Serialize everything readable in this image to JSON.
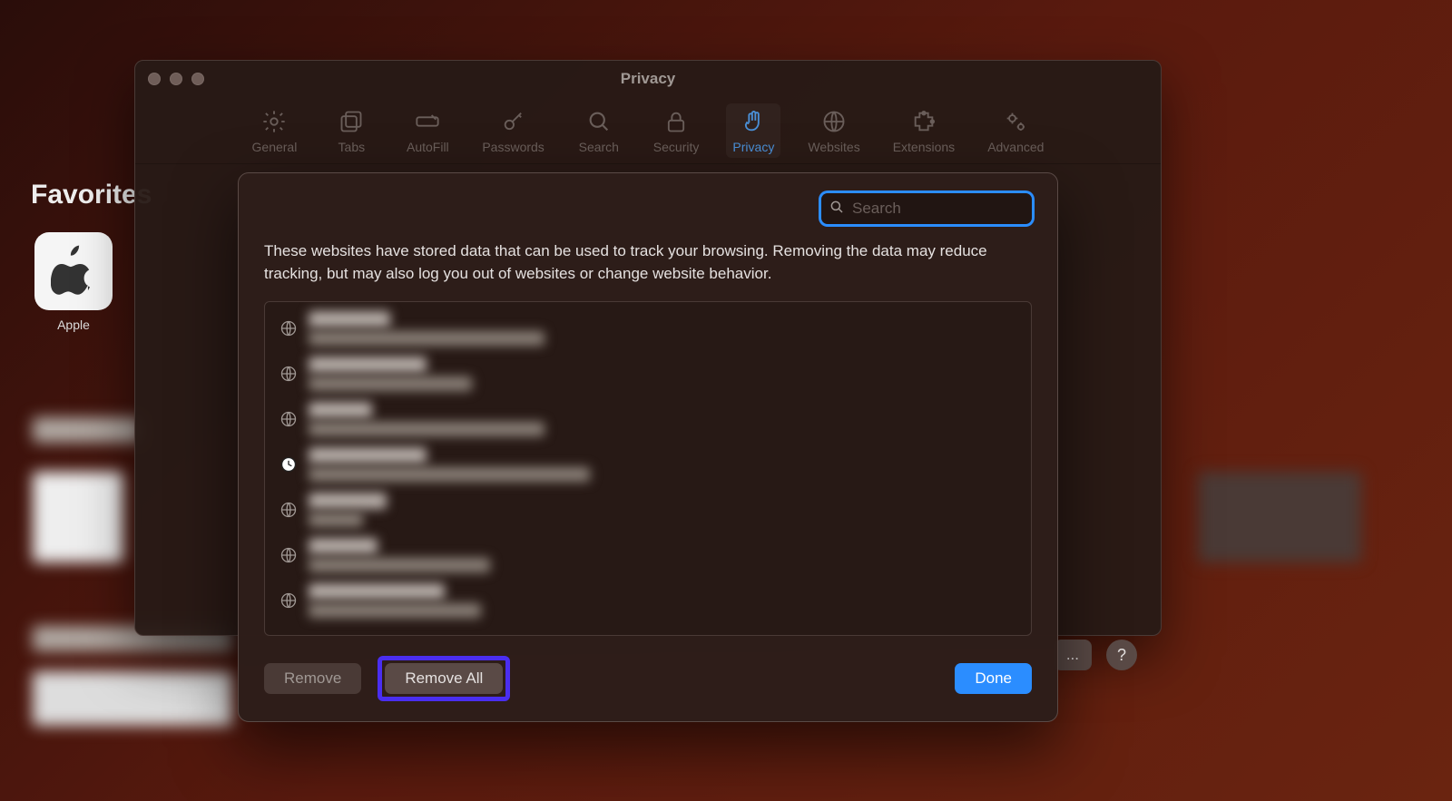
{
  "background": {
    "favorites_heading": "Favorites",
    "tiles": [
      {
        "label": "Apple",
        "icon": "apple-logo-icon"
      }
    ]
  },
  "window": {
    "title": "Privacy",
    "traffic_lights": [
      "close",
      "minimize",
      "maximize"
    ],
    "toolbar": [
      {
        "id": "general",
        "label": "General",
        "icon": "gear-icon",
        "active": false
      },
      {
        "id": "tabs",
        "label": "Tabs",
        "icon": "tabs-icon",
        "active": false
      },
      {
        "id": "autofill",
        "label": "AutoFill",
        "icon": "pen-icon",
        "active": false
      },
      {
        "id": "passwords",
        "label": "Passwords",
        "icon": "key-icon",
        "active": false
      },
      {
        "id": "search",
        "label": "Search",
        "icon": "search-icon",
        "active": false
      },
      {
        "id": "security",
        "label": "Security",
        "icon": "lock-icon",
        "active": false
      },
      {
        "id": "privacy",
        "label": "Privacy",
        "icon": "hand-icon",
        "active": true
      },
      {
        "id": "websites",
        "label": "Websites",
        "icon": "globe-icon",
        "active": false
      },
      {
        "id": "extensions",
        "label": "Extensions",
        "icon": "puzzle-icon",
        "active": false
      },
      {
        "id": "advanced",
        "label": "Advanced",
        "icon": "gears-icon",
        "active": false
      }
    ],
    "below_controls": {
      "details_button_label": "...",
      "help_button_label": "?"
    }
  },
  "modal": {
    "search": {
      "placeholder": "Search",
      "value": ""
    },
    "description": "These websites have stored data that can be used to track your browsing. Removing the data may reduce tracking, but may also log you out of websites or change website behavior.",
    "rows": [
      {
        "icon": "globe-icon",
        "name_redacted": true,
        "detail_redacted": true
      },
      {
        "icon": "globe-icon",
        "name_redacted": true,
        "detail_redacted": true
      },
      {
        "icon": "globe-icon",
        "name_redacted": true,
        "detail_redacted": true
      },
      {
        "icon": "clock-icon",
        "name_redacted": true,
        "detail_redacted": true
      },
      {
        "icon": "globe-icon",
        "name_redacted": true,
        "detail_redacted": true
      },
      {
        "icon": "globe-icon",
        "name_redacted": true,
        "detail_redacted": true
      },
      {
        "icon": "globe-icon",
        "name_redacted": true,
        "detail_redacted": true
      }
    ],
    "buttons": {
      "remove": "Remove",
      "remove_all": "Remove All",
      "done": "Done"
    },
    "highlighted_button": "remove_all"
  }
}
